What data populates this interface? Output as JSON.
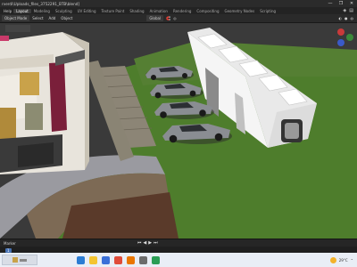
{
  "window": {
    "title": "rverdi\\Uploads_files_3752291_BTB\\blend]",
    "controls": [
      "—",
      "❐",
      "✕"
    ]
  },
  "menubar": {
    "menus": [
      "Help"
    ],
    "workspaces": [
      "Layout",
      "Modeling",
      "Sculpting",
      "UV Editing",
      "Texture Paint",
      "Shading",
      "Animation",
      "Rendering",
      "Compositing",
      "Geometry Nodes",
      "Scripting"
    ],
    "active_workspace": "Layout"
  },
  "header": {
    "left_items": [
      "Select",
      "Add",
      "Object"
    ],
    "mode": "Object Mode",
    "transform": "Global",
    "select_box_label": "Select Box"
  },
  "timeline": {
    "label": "Marker",
    "current_frame": "1",
    "playback": [
      "⏮",
      "◀",
      "▶",
      "⏭"
    ]
  },
  "taskbar": {
    "weather": "29°C",
    "apps": [
      {
        "name": "edge-icon",
        "color": "#2b7cd3"
      },
      {
        "name": "file-explorer-icon",
        "color": "#f4c430"
      },
      {
        "name": "store-icon",
        "color": "#3a6fd8"
      },
      {
        "name": "chrome-icon",
        "color": "#e04b3a"
      },
      {
        "name": "blender-icon",
        "color": "#ea7600"
      },
      {
        "name": "camera-icon",
        "color": "#6b6b6b"
      },
      {
        "name": "app-icon",
        "color": "#2a9d55"
      }
    ]
  },
  "colors": {
    "viewport_bg": "#3a3a3a",
    "grass": "#4a7a2a",
    "accent": "#4772b3"
  }
}
